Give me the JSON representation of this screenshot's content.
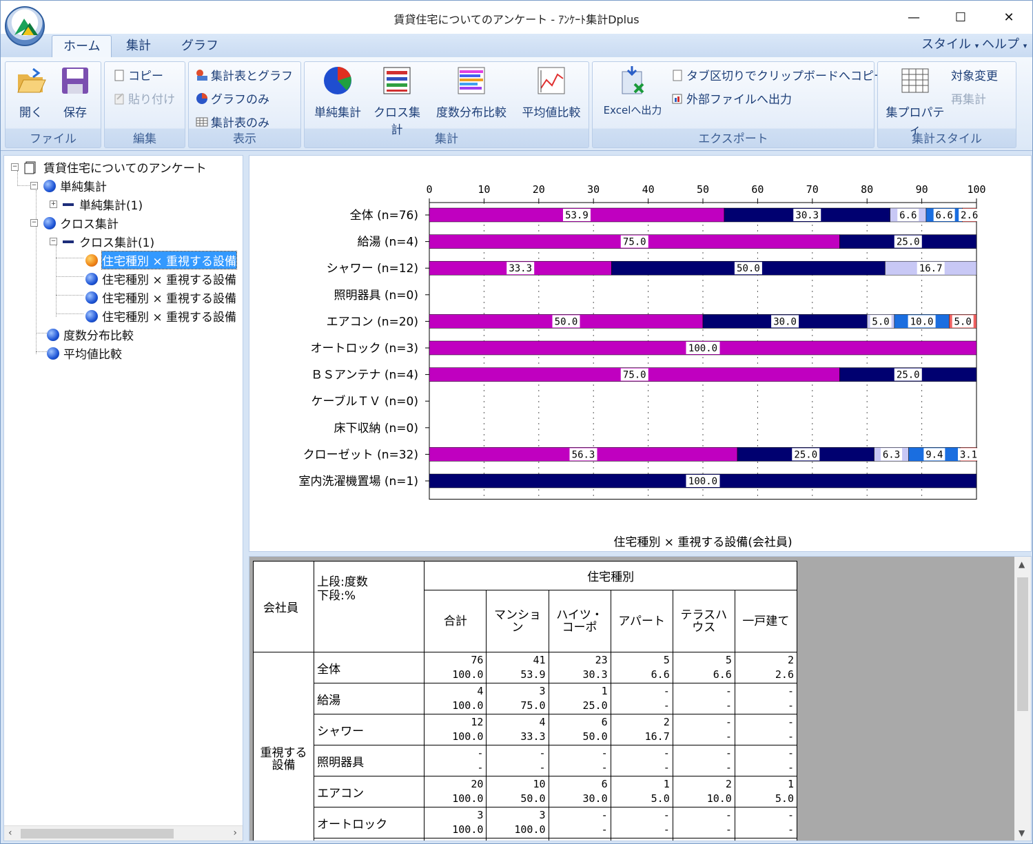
{
  "window": {
    "title": "賃貸住宅についてのアンケート - ｱﾝｹｰﾄ集計Dplus",
    "minimize": "—",
    "maximize": "☐",
    "close": "✕"
  },
  "tabs": [
    "ホーム",
    "集計",
    "グラフ"
  ],
  "menu_right": {
    "style": "スタイル",
    "help": "ヘルプ"
  },
  "ribbon": {
    "file": {
      "label": "ファイル",
      "open": "開く",
      "save": "保存"
    },
    "edit": {
      "label": "編集",
      "copy": "コピー",
      "paste": "貼り付け"
    },
    "view": {
      "label": "表示",
      "table_graph": "集計表とグラフ",
      "graph_only": "グラフのみ",
      "table_only": "集計表のみ"
    },
    "agg": {
      "label": "集計",
      "simple": "単純集計",
      "cross": "クロス集計",
      "freq": "度数分布比較",
      "mean": "平均値比較"
    },
    "export": {
      "label": "エクスポート",
      "excel": "Excelへ出力",
      "clipboard": "タブ区切りでクリップボードへコピー",
      "external": "外部ファイルへ出力"
    },
    "style": {
      "label": "集計スタイル",
      "property": "集プロパティ",
      "target": "対象変更",
      "reagg": "再集計"
    }
  },
  "tree": {
    "root": "賃貸住宅についてのアンケート",
    "simple": "単純集計",
    "simple1": "単純集計(1)",
    "cross": "クロス集計",
    "cross1": "クロス集計(1)",
    "items": [
      "住宅種別 × 重視する設備",
      "住宅種別 × 重視する設備",
      "住宅種別 × 重視する設備",
      "住宅種別 × 重視する設備"
    ],
    "freq": "度数分布比較",
    "mean": "平均値比較"
  },
  "chart_data": {
    "type": "bar",
    "stacked": true,
    "orientation": "horizontal",
    "title": "住宅種別 × 重視する設備(会社員)",
    "xlim": [
      0,
      100
    ],
    "xticks": [
      0,
      10,
      20,
      30,
      40,
      50,
      60,
      70,
      80,
      90,
      100
    ],
    "grid": "dotted vertical",
    "categories": [
      "全体 (n=76)",
      "給湯 (n=4)",
      "シャワー (n=12)",
      "照明器具 (n=0)",
      "エアコン (n=20)",
      "オートロック (n=3)",
      "ＢＳアンテナ (n=4)",
      "ケーブルＴＶ (n=0)",
      "床下収納 (n=0)",
      "クローゼット (n=32)",
      "室内洗濯機置場 (n=1)"
    ],
    "series": [
      {
        "color": "#c000c0",
        "values": [
          53.9,
          75.0,
          33.3,
          0,
          50.0,
          100.0,
          75.0,
          0,
          0,
          56.3,
          0
        ]
      },
      {
        "color": "#000070",
        "values": [
          30.3,
          25.0,
          50.0,
          0,
          30.0,
          0,
          25.0,
          0,
          0,
          25.0,
          100.0
        ]
      },
      {
        "color": "#c8c8f5",
        "values": [
          6.6,
          0,
          16.7,
          0,
          5.0,
          0,
          0,
          0,
          0,
          6.3,
          0
        ]
      },
      {
        "color": "#1a6ee0",
        "values": [
          6.6,
          0,
          0,
          0,
          10.0,
          0,
          0,
          0,
          0,
          9.4,
          0
        ]
      },
      {
        "color": "#f06060",
        "values": [
          2.6,
          0,
          0,
          0,
          5.0,
          0,
          0,
          0,
          0,
          3.1,
          0
        ]
      }
    ]
  },
  "table": {
    "corner_left": "会社員",
    "corner_note1": "上段:度数",
    "corner_note2": "下段:%",
    "group_header": "住宅種別",
    "columns": [
      "合計",
      "マンション",
      "ハイツ・コーポ",
      "アパート",
      "テラスハウス",
      "一戸建て"
    ],
    "row_group": "重視する設備",
    "rows": [
      {
        "label": "全体",
        "counts": [
          "76",
          "41",
          "23",
          "5",
          "5",
          "2"
        ],
        "pcts": [
          "100.0",
          "53.9",
          "30.3",
          "6.6",
          "6.6",
          "2.6"
        ]
      },
      {
        "label": "給湯",
        "counts": [
          "4",
          "3",
          "1",
          "-",
          "-",
          "-"
        ],
        "pcts": [
          "100.0",
          "75.0",
          "25.0",
          "-",
          "-",
          "-"
        ]
      },
      {
        "label": "シャワー",
        "counts": [
          "12",
          "4",
          "6",
          "2",
          "-",
          "-"
        ],
        "pcts": [
          "100.0",
          "33.3",
          "50.0",
          "16.7",
          "-",
          "-"
        ]
      },
      {
        "label": "照明器具",
        "counts": [
          "-",
          "-",
          "-",
          "-",
          "-",
          "-"
        ],
        "pcts": [
          "-",
          "-",
          "-",
          "-",
          "-",
          "-"
        ]
      },
      {
        "label": "エアコン",
        "counts": [
          "20",
          "10",
          "6",
          "1",
          "2",
          "1"
        ],
        "pcts": [
          "100.0",
          "50.0",
          "30.0",
          "5.0",
          "10.0",
          "5.0"
        ]
      },
      {
        "label": "オートロック",
        "counts": [
          "3",
          "3",
          "-",
          "-",
          "-",
          "-"
        ],
        "pcts": [
          "100.0",
          "100.0",
          "-",
          "-",
          "-",
          "-"
        ]
      }
    ]
  }
}
